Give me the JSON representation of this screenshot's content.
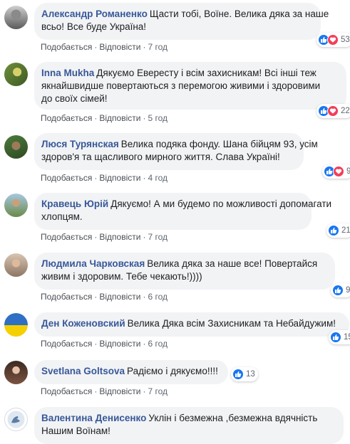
{
  "colors": {
    "author_link": "#385898",
    "bubble_bg": "#f2f3f5",
    "like_blue": "#1877f2",
    "love_red": "#f33e58"
  },
  "labels": {
    "like": "Подобається",
    "reply": "Відповісти",
    "separator": "·"
  },
  "comments": [
    {
      "author": "Александр Романенко",
      "lines": [
        "Щасти тобі, Воїне. Велика дяка за наше",
        "всьо! Все буде Україна!"
      ],
      "time": "7 год",
      "reactions": [
        "like",
        "love"
      ],
      "count": "53",
      "avatar_icon": "profile-photo"
    },
    {
      "author": "Inna Mukha",
      "lines": [
        "Дякуємо Евересту і всім захисникам! Всі інші теж",
        "якнайшвидше повертаються з перемогою живими і здоровими",
        "до своїх сімей!"
      ],
      "time": "5 год",
      "reactions": [
        "like",
        "love"
      ],
      "count": "22",
      "avatar_icon": "profile-photo"
    },
    {
      "author": "Люся Турянская",
      "lines": [
        "Велика подяка фонду. Шана бійцям 93, усім",
        "здоров'я та щасливого мирного життя. Слава Україні!"
      ],
      "time": "4 год",
      "reactions": [
        "like",
        "love"
      ],
      "count": "9",
      "avatar_icon": "profile-photo"
    },
    {
      "author": "Кравець Юрій",
      "lines": [
        "Дякуємо! А ми будемо по можливості допомагати",
        "хлопцям."
      ],
      "time": "7 год",
      "reactions": [
        "like"
      ],
      "count": "21",
      "avatar_icon": "profile-photo"
    },
    {
      "author": "Людмила Чарковская",
      "lines": [
        "Велика дяка за наше все! Повертайся",
        "живим і здоровим. Тебе чекають!))))"
      ],
      "time": "6 год",
      "reactions": [
        "like"
      ],
      "count": "9",
      "avatar_icon": "profile-photo"
    },
    {
      "author": "Ден Коженовский",
      "lines": [
        "Велика Дяка всім Захисникам та Небайдужим!"
      ],
      "time": "6 год",
      "reactions": [
        "like"
      ],
      "count": "15",
      "avatar_icon": "ukraine-flag-avatar"
    },
    {
      "author": "Svetlana Goltsova",
      "lines": [
        "Радіємо і дякуємо!!!!"
      ],
      "time": "7 год",
      "reactions": [
        "like"
      ],
      "count": "13",
      "avatar_icon": "profile-photo"
    },
    {
      "author": "Валентина Денисенко",
      "lines": [
        "Уклін і безмежна ,безмежна вдячність",
        "Нашим Воїнам!"
      ],
      "time": "",
      "reactions": [],
      "count": "",
      "avatar_icon": "emblem-avatar"
    }
  ]
}
